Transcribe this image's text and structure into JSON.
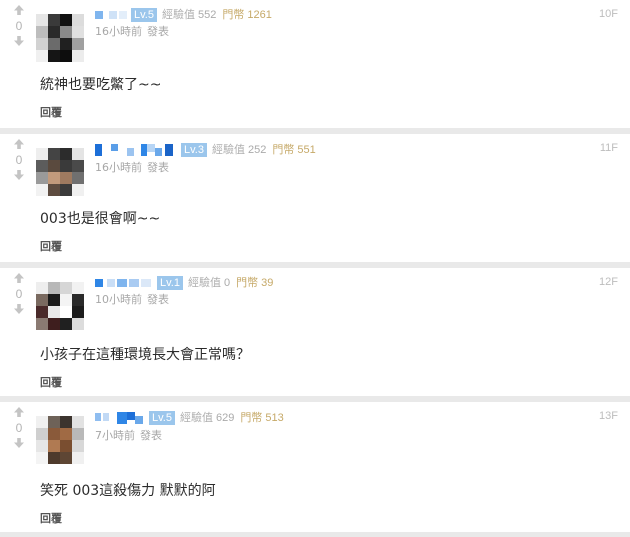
{
  "comments": [
    {
      "floor": "10F",
      "votes": "0",
      "level": "Lv.5",
      "exp_label": "經驗值",
      "exp": "552",
      "coin_label": "門幣",
      "coin": "1261",
      "time": "16小時前",
      "action": "發表",
      "content": "統神也要吃鱉了~~",
      "reply": "回覆"
    },
    {
      "floor": "11F",
      "votes": "0",
      "level": "Lv.3",
      "exp_label": "經驗值",
      "exp": "252",
      "coin_label": "門幣",
      "coin": "551",
      "time": "16小時前",
      "action": "發表",
      "content": "003也是很會啊~~",
      "reply": "回覆"
    },
    {
      "floor": "12F",
      "votes": "0",
      "level": "Lv.1",
      "exp_label": "經驗值",
      "exp": "0",
      "coin_label": "門幣",
      "coin": "39",
      "time": "10小時前",
      "action": "發表",
      "content": "小孩子在這種環境長大會正常嗎？",
      "reply": "回覆"
    },
    {
      "floor": "13F",
      "votes": "0",
      "level": "Lv.5",
      "exp_label": "經驗值",
      "exp": "629",
      "coin_label": "門幣",
      "coin": "513",
      "time": "7小時前",
      "action": "發表",
      "content": "笑死 003這殺傷力 默默的阿",
      "reply": "回覆"
    }
  ],
  "colors": {
    "background": "#e9e9e9",
    "card": "#ffffff",
    "level_badge": "#9bc6ec",
    "coin_text": "#c6a968",
    "username_blue": "#2f86e6"
  },
  "icons": [
    "arrow-up-icon",
    "arrow-down-icon"
  ]
}
